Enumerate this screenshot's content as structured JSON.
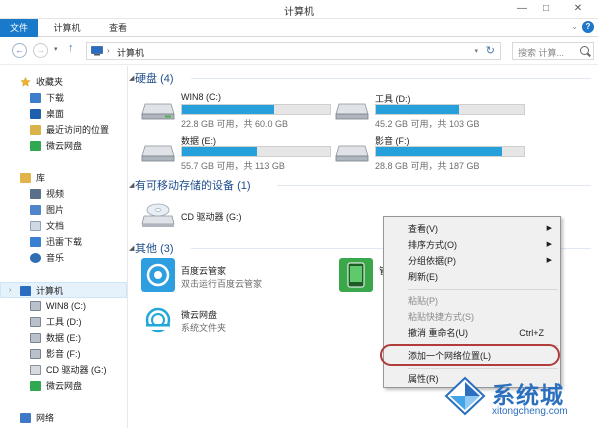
{
  "window": {
    "title": "计算机",
    "minimize": "—",
    "maximize": "□",
    "close": "✕"
  },
  "ribbon": {
    "tabs": [
      "文件",
      "计算机",
      "查看"
    ],
    "expand_glyph": "⌄",
    "help_glyph": "?"
  },
  "navbar": {
    "back": "←",
    "forward": "→",
    "history": "▾",
    "up": "↑",
    "crumb_sep": "›",
    "breadcrumb": "计算机",
    "address_dropdown": "▾",
    "refresh": "↻",
    "search_placeholder": "搜索 计算..."
  },
  "sidebar": {
    "favorites_header": "收藏夹",
    "favorites": [
      "下载",
      "桌面",
      "最近访问的位置",
      "微云网盘"
    ],
    "libraries_header": "库",
    "libraries": [
      "视频",
      "图片",
      "文档",
      "迅雷下载",
      "音乐"
    ],
    "computer_header": "计算机",
    "computer_items": [
      "WIN8 (C:)",
      "工具 (D:)",
      "数据 (E:)",
      "影音 (F:)",
      "CD 驱动器 (G:)",
      "微云网盘"
    ],
    "network_header": "网络",
    "expand_glyph": "›"
  },
  "main": {
    "group_toggle": "◢",
    "hard_disks": {
      "title": "硬盘",
      "count": "(4)"
    },
    "drives": [
      {
        "name": "WIN8 (C:)",
        "info": "22.8 GB 可用，共 60.0 GB",
        "used_fraction": 0.62
      },
      {
        "name": "工具 (D:)",
        "info": "45.2 GB 可用，共 103 GB",
        "used_fraction": 0.56
      },
      {
        "name": "数据 (E:)",
        "info": "55.7 GB 可用，共 113 GB",
        "used_fraction": 0.51
      },
      {
        "name": "影音 (F:)",
        "info": "28.8 GB 可用，共 187 GB",
        "used_fraction": 0.85
      }
    ],
    "removable": {
      "title": "有可移动存储的设备",
      "count": "(1)",
      "cd_name": "CD 驱动器 (G:)"
    },
    "other": {
      "title": "其他",
      "count": "(3)"
    },
    "apps": [
      {
        "name": "百度云管家",
        "desc": "双击运行百度云管家"
      },
      {
        "name": "微云网盘",
        "desc": "系统文件夹"
      },
      {
        "name": "管",
        "desc": ""
      }
    ]
  },
  "context_menu": {
    "items": [
      {
        "label": "查看(V)",
        "submenu": "▶"
      },
      {
        "label": "排序方式(O)",
        "submenu": "▶"
      },
      {
        "label": "分组依据(P)",
        "submenu": "▶"
      },
      {
        "label": "刷新(E)"
      },
      {
        "label": "粘贴(P)",
        "disabled": true
      },
      {
        "label": "粘贴快捷方式(S)",
        "disabled": true
      },
      {
        "label": "撤消 重命名(U)",
        "shortcut": "Ctrl+Z"
      },
      {
        "label": "添加一个网络位置(L)",
        "highlighted": true
      },
      {
        "label": "属性(R)"
      }
    ]
  },
  "watermark": {
    "brand": "系统城",
    "url": "xitongcheng.com"
  },
  "colors": {
    "accent": "#1979ca",
    "progress": "#26a0da",
    "group_header": "#1e4d8c",
    "highlight_ring": "#b03c3c"
  }
}
